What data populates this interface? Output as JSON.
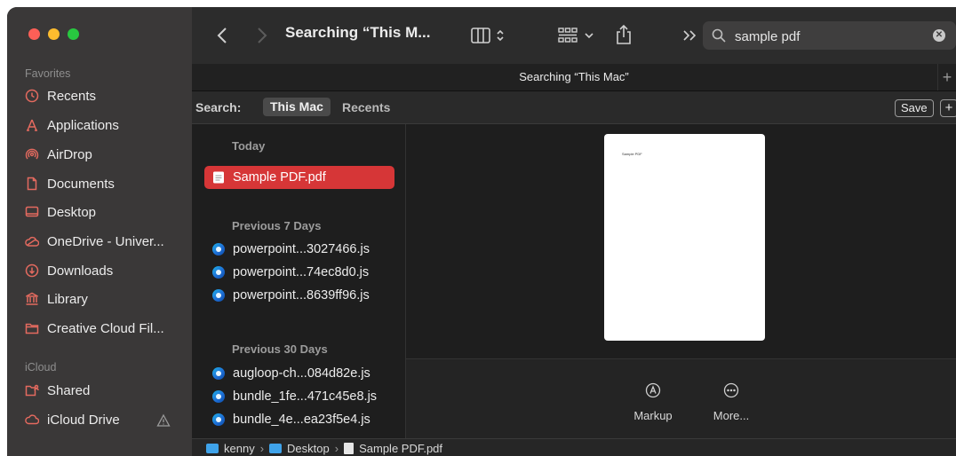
{
  "window": {
    "sidebar": {
      "favorites_header": "Favorites",
      "favorites": [
        {
          "label": "Recents",
          "icon": "clock-icon"
        },
        {
          "label": "Applications",
          "icon": "applications-icon"
        },
        {
          "label": "AirDrop",
          "icon": "airdrop-icon"
        },
        {
          "label": "Documents",
          "icon": "document-icon"
        },
        {
          "label": "Desktop",
          "icon": "desktop-icon"
        },
        {
          "label": "OneDrive - Univer...",
          "icon": "cloud-icon"
        },
        {
          "label": "Downloads",
          "icon": "download-icon"
        },
        {
          "label": "Library",
          "icon": "library-icon"
        },
        {
          "label": "Creative Cloud Fil...",
          "icon": "folder-icon"
        }
      ],
      "icloud_header": "iCloud",
      "icloud": [
        {
          "label": "Shared",
          "icon": "shared-folder-icon"
        },
        {
          "label": "iCloud Drive",
          "icon": "icloud-icon"
        }
      ]
    },
    "toolbar": {
      "title": "Searching “This M...",
      "search_value": "sample pdf"
    },
    "tab": {
      "label": "Searching “This Mac”",
      "plus": "+"
    },
    "scope": {
      "label": "Search:",
      "this_mac": "This Mac",
      "recents": "Recents",
      "save": "Save",
      "add": "+"
    },
    "results": {
      "groups": [
        {
          "header": "Today",
          "files": [
            "Sample PDF.pdf"
          ]
        },
        {
          "header": "Previous 7 Days",
          "files": [
            "powerpoint...3027466.js",
            "powerpoint...74ec8d0.js",
            "powerpoint...8639ff96.js"
          ]
        },
        {
          "header": "Previous 30 Days",
          "files": [
            "augloop-ch...084d82e.js",
            "bundle_1fe...471c45e8.js",
            "bundle_4e...ea23f5e4.js"
          ]
        }
      ],
      "selected": "Sample PDF.pdf"
    },
    "preview": {
      "page_text": "Sample PDF",
      "actions": [
        {
          "label": "Markup",
          "icon": "markup-icon"
        },
        {
          "label": "More...",
          "icon": "more-icon"
        }
      ]
    },
    "pathbar": [
      "kenny",
      "Desktop",
      "Sample PDF.pdf"
    ],
    "colors": {
      "selection": "#d63637",
      "sidebar_bg": "#3a3838",
      "content_bg": "#1e1e1e",
      "folder_blue": "#3fa3ea"
    }
  }
}
